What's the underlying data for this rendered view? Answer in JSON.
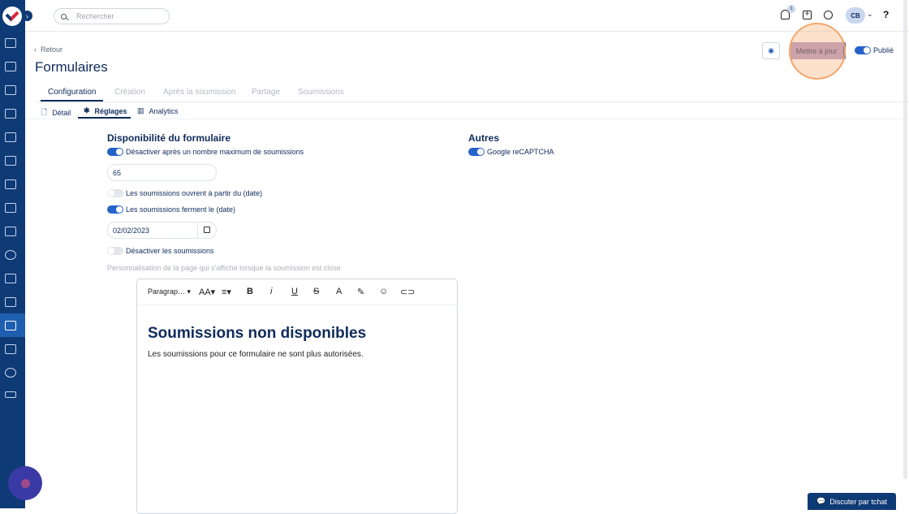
{
  "search": {
    "placeholder": "Rechercher"
  },
  "header": {
    "notification_count": "1",
    "avatar_initials": "CB",
    "help_label": "?"
  },
  "nav": {
    "back_label": "Retour"
  },
  "page": {
    "title": "Formulaires"
  },
  "actions": {
    "update_label": "Mettre à jour",
    "published_label": "Publié"
  },
  "tabs": [
    {
      "label": "Configuration"
    },
    {
      "label": "Création"
    },
    {
      "label": "Après la soumission"
    },
    {
      "label": "Partage"
    },
    {
      "label": "Soumissions"
    }
  ],
  "subtabs": [
    {
      "label": "Détail"
    },
    {
      "label": "Réglages"
    },
    {
      "label": "Analytics"
    }
  ],
  "availability": {
    "title": "Disponibilité du formulaire",
    "max_label": "Désactiver après un nombre maximum de soumissions",
    "max_value": "65",
    "open_label": "Les soumissions ouvrent à partir du (date)",
    "close_label": "Les soumissions ferment le (date)",
    "close_date": "02/02/2023",
    "disable_label": "Désactiver les soumissions",
    "custom_hint": "Personnalisation de la page qui s'affiche lorsque la soumission est close"
  },
  "others": {
    "title": "Autres",
    "recaptcha_label": "Google reCAPTCHA"
  },
  "editor": {
    "paragraph_label": "Paragrap…",
    "heading": "Soumissions non disponibles",
    "body": "Les soumissions pour ce formulaire ne sont plus autorisées."
  },
  "chat": {
    "label": "Discuter par tchat"
  }
}
